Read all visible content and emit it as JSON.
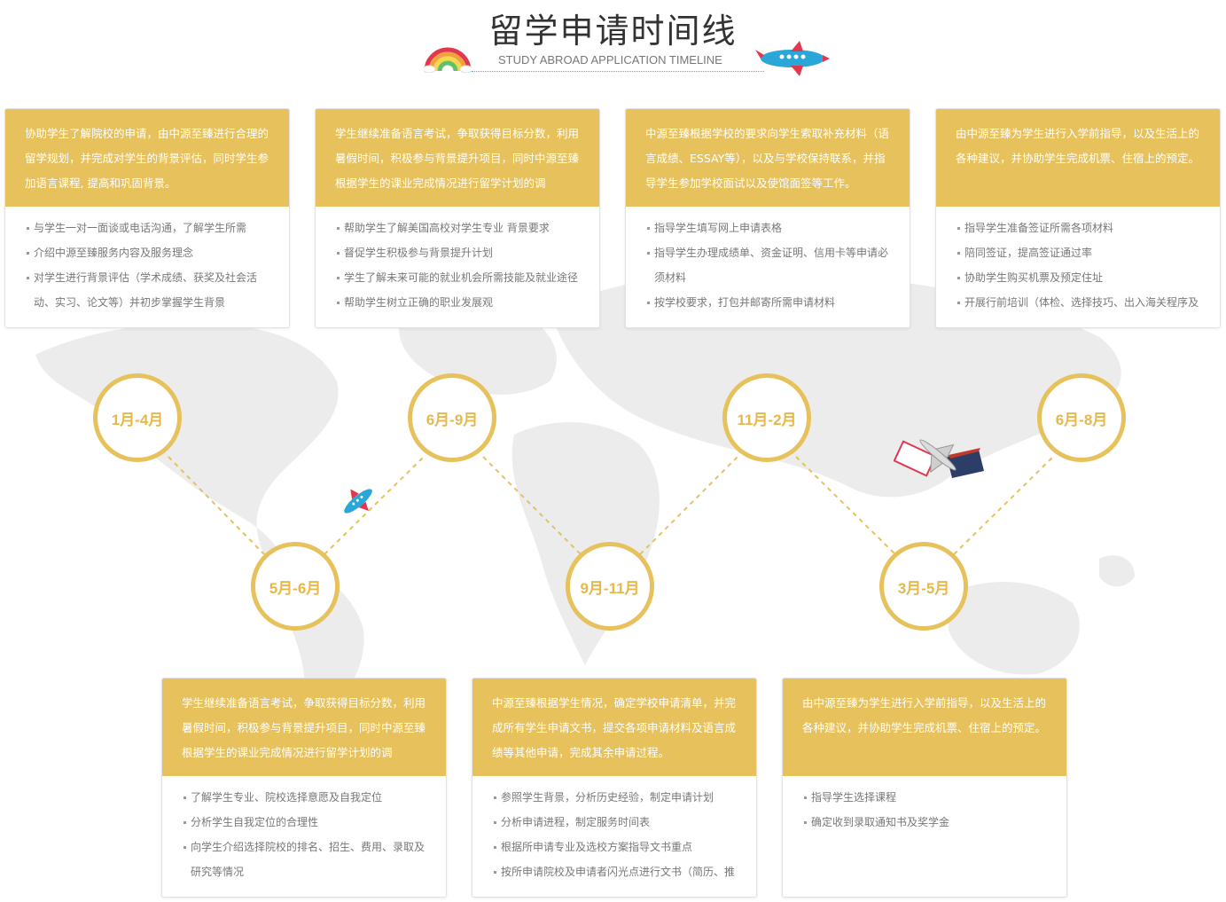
{
  "header": {
    "title": "留学申请时间线",
    "subtitle": "STUDY ABROAD APPLICATION TIMELINE"
  },
  "colors": {
    "accent": "#e6c15c",
    "node_text": "#e6b84a",
    "map_gray": "#ececec",
    "plane_blue": "#2aa7d8",
    "plane_red": "#e0394f"
  },
  "timeline": [
    {
      "label": "1月-4月"
    },
    {
      "label": "5月-6月"
    },
    {
      "label": "6月-9月"
    },
    {
      "label": "9月-11月"
    },
    {
      "label": "11月-2月"
    },
    {
      "label": "3月-5月"
    },
    {
      "label": "6月-8月"
    }
  ],
  "cards_top": [
    {
      "head": "协助学生了解院校的申请，由中源至臻进行合理的留学规划，并完成对学生的背景评估，同时学生参加语言课程, 提高和巩固背景。",
      "items": [
        "与学生一对一面谈或电话沟通，了解学生所需",
        "介绍中源至臻服务内容及服务理念",
        "对学生进行背景评估（学术成绩、获奖及社会活动、实习、论文等）并初步掌握学生背景"
      ]
    },
    {
      "head": "学生继续准备语言考试，争取获得目标分数，利用暑假时间，积极参与背景提升项目，同时中源至臻根据学生的课业完成情况进行留学计划的调",
      "items": [
        "帮助学生了解美国高校对学生专业 背景要求",
        "督促学生积极参与背景提升计划",
        "学生了解未来可能的就业机会所需技能及就业途径",
        "帮助学生树立正确的职业发展观"
      ]
    },
    {
      "head": "中源至臻根据学校的要求向学生索取补充材料（语言成绩、ESSAY等），以及与学校保持联系，并指导学生参加学校面试以及使馆面签等工作。",
      "items": [
        "指导学生填写网上申请表格",
        "指导学生办理成绩单、资金证明、信用卡等申请必须材料",
        "按学校要求，打包并邮寄所需申请材料"
      ]
    },
    {
      "head": "由中源至臻为学生进行入学前指导，以及生活上的各种建议，并协助学生完成机票、住宿上的预定。",
      "items": [
        "指导学生准备签证所需各项材料",
        "陪同签证，提高签证通过率",
        "协助学生购买机票及预定住址",
        "开展行前培训（体检、选择技巧、出入海关程序及"
      ]
    }
  ],
  "cards_bottom": [
    {
      "head": "学生继续准备语言考试，争取获得目标分数，利用暑假时间，积极参与背景提升项目，同时中源至臻根据学生的课业完成情况进行留学计划的调",
      "items": [
        "了解学生专业、院校选择意愿及自我定位",
        "分析学生自我定位的合理性",
        "向学生介绍选择院校的排名、招生、费用、录取及研究等情况"
      ]
    },
    {
      "head": "中源至臻根据学生情况，确定学校申请清单，并完成所有学生申请文书，提交各项申请材料及语言成绩等其他申请，完成其余申请过程。",
      "items": [
        "参照学生背景，分析历史经验，制定申请计划",
        "分析申请进程，制定服务时间表",
        "根据所申请专业及选校方案指导文书重点",
        "按所申请院校及申请者闪光点进行文书（简历、推"
      ]
    },
    {
      "head": "由中源至臻为学生进行入学前指导，以及生活上的各种建议，并协助学生完成机票、住宿上的预定。",
      "items": [
        "指导学生选择课程",
        "确定收到录取通知书及奖学金"
      ]
    }
  ]
}
